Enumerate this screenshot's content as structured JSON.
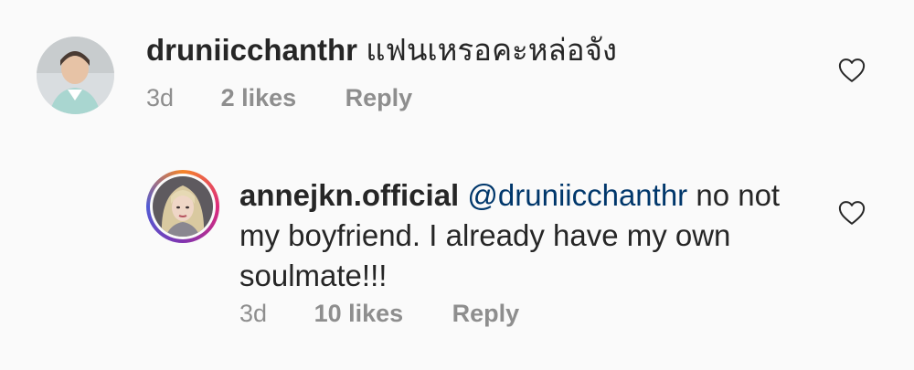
{
  "comments": [
    {
      "username": "druniicchanthr",
      "text": "แฟนเหรอคะหล่อจัง",
      "time": "3d",
      "likes": "2 likes",
      "reply": "Reply",
      "avatar_icon": "user-avatar-icon",
      "like_icon": "heart-outline-icon"
    },
    {
      "username": "annejkn.official",
      "mention": "@druniicchanthr",
      "text_line1": " no not",
      "text_line2": "my boyfriend. I already have my own",
      "text_line3": "soulmate!!!",
      "time": "3d",
      "likes": "10 likes",
      "reply": "Reply",
      "avatar_icon": "story-ring-avatar-icon",
      "like_icon": "heart-outline-icon"
    }
  ],
  "colors": {
    "background": "#fafafa",
    "text": "#262626",
    "meta": "#8e8e8e",
    "mention": "#00376b"
  }
}
